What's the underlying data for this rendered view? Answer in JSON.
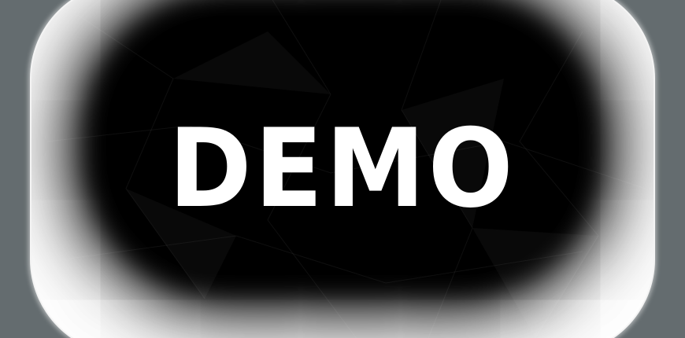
{
  "badge": {
    "text": "DEMO"
  },
  "colors": {
    "background": "#646c6f",
    "frame": "#ffffff",
    "core": "#000000",
    "text": "#ffffff"
  }
}
